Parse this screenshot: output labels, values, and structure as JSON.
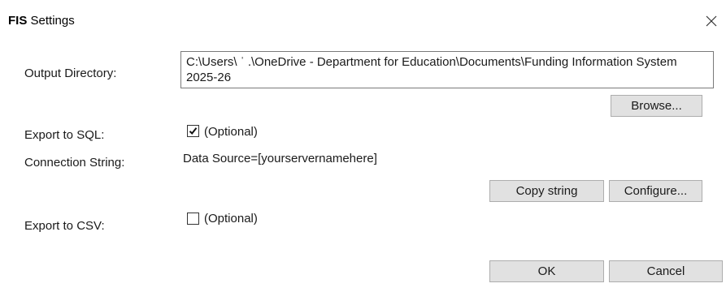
{
  "window": {
    "title_brand": "FIS",
    "title_rest": " Settings"
  },
  "output_directory": {
    "label": "Output Directory:",
    "value": "C:\\Users\\ ˈ       .\\OneDrive - Department for Education\\Documents\\Funding Information System 2025-26",
    "browse_label": "Browse..."
  },
  "export_sql": {
    "label": "Export to SQL:",
    "checked": true,
    "optional_text": "(Optional)"
  },
  "connection_string": {
    "label": "Connection String:",
    "value": "Data Source=[yourservernamehere]",
    "copy_label": "Copy string",
    "configure_label": "Configure..."
  },
  "export_csv": {
    "label": "Export to CSV:",
    "checked": false,
    "optional_text": "(Optional)"
  },
  "footer": {
    "ok_label": "OK",
    "cancel_label": "Cancel"
  },
  "icons": {
    "close": "close-icon",
    "check": "checkmark-icon"
  }
}
